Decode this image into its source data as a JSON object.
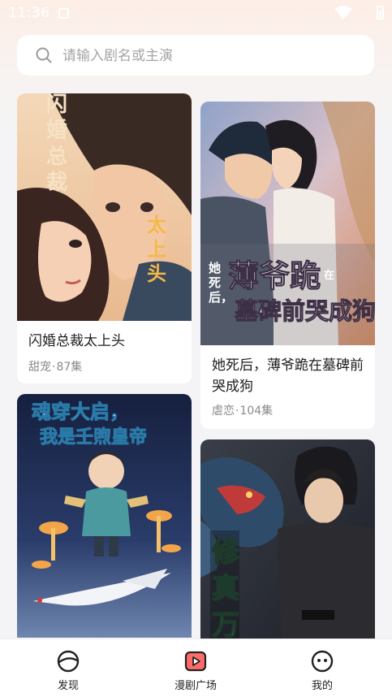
{
  "status_bar": {
    "time": "11:36"
  },
  "search": {
    "placeholder": "请输入剧名或主演"
  },
  "dramas": [
    {
      "title": "闪婚总裁太上头",
      "genre": "甜宠",
      "episodes": "87集",
      "cover_text": [
        "闪婚总裁",
        "太上头"
      ]
    },
    {
      "title": "她死后，薄爷跪在墓碑前哭成狗",
      "genre": "虐恋",
      "episodes": "104集",
      "cover_text": [
        "她死后，",
        "薄爷跪",
        "在",
        "墓碑前哭成狗"
      ]
    },
    {
      "title": "",
      "genre": "",
      "episodes": "",
      "cover_text": [
        "魂穿大启，",
        "我是壬煦皇帝"
      ]
    },
    {
      "title": "",
      "genre": "",
      "episodes": "",
      "cover_text": [
        "修真万"
      ]
    }
  ],
  "meta_separator": "·",
  "bottom_nav": [
    {
      "label": "发现",
      "icon": "discover-icon"
    },
    {
      "label": "漫剧广场",
      "icon": "drama-play-icon",
      "active": true
    },
    {
      "label": "我的",
      "icon": "profile-face-icon"
    }
  ],
  "colors": {
    "accent": "#ff6a6a",
    "text_primary": "#1e1e1e",
    "text_secondary": "#8a8a8e"
  }
}
